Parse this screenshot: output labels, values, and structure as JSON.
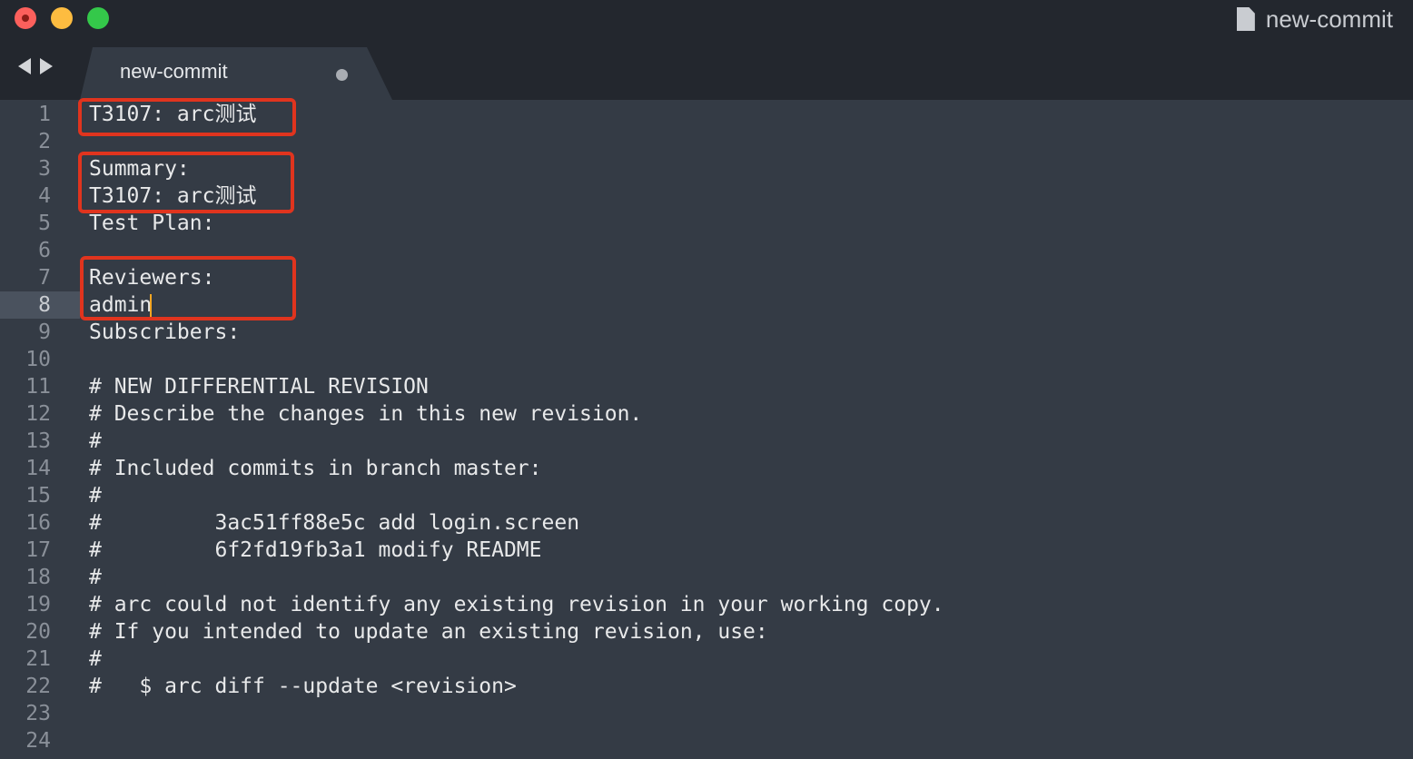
{
  "window": {
    "title": "new-commit",
    "title_icon": "document-icon"
  },
  "tab": {
    "label": "new-commit",
    "modified_indicator": "dot"
  },
  "navigation": {
    "back": "chevron-left-icon",
    "forward": "chevron-right-icon"
  },
  "editor": {
    "active_line": 8,
    "lines": [
      {
        "number": "1",
        "text": "T3107: arc测试"
      },
      {
        "number": "2",
        "text": ""
      },
      {
        "number": "3",
        "text": "Summary:"
      },
      {
        "number": "4",
        "text": "T3107: arc测试"
      },
      {
        "number": "5",
        "text": "Test Plan:"
      },
      {
        "number": "6",
        "text": ""
      },
      {
        "number": "7",
        "text": "Reviewers:"
      },
      {
        "number": "8",
        "text": "admin"
      },
      {
        "number": "9",
        "text": "Subscribers:"
      },
      {
        "number": "10",
        "text": ""
      },
      {
        "number": "11",
        "text": "# NEW DIFFERENTIAL REVISION"
      },
      {
        "number": "12",
        "text": "# Describe the changes in this new revision."
      },
      {
        "number": "13",
        "text": "#"
      },
      {
        "number": "14",
        "text": "# Included commits in branch master:"
      },
      {
        "number": "15",
        "text": "#"
      },
      {
        "number": "16",
        "text": "#         3ac51ff88e5c add login.screen"
      },
      {
        "number": "17",
        "text": "#         6f2fd19fb3a1 modify README"
      },
      {
        "number": "18",
        "text": "#"
      },
      {
        "number": "19",
        "text": "# arc could not identify any existing revision in your working copy."
      },
      {
        "number": "20",
        "text": "# If you intended to update an existing revision, use:"
      },
      {
        "number": "21",
        "text": "#"
      },
      {
        "number": "22",
        "text": "#   $ arc diff --update <revision>"
      },
      {
        "number": "23",
        "text": ""
      },
      {
        "number": "24",
        "text": ""
      }
    ]
  },
  "colors": {
    "titlebar": "#23272e",
    "editor_bg": "#343b45",
    "text": "#e8e9ea",
    "gutter_text": "#8a9099",
    "caret": "#f5a623",
    "annotation": "#e0341e"
  }
}
